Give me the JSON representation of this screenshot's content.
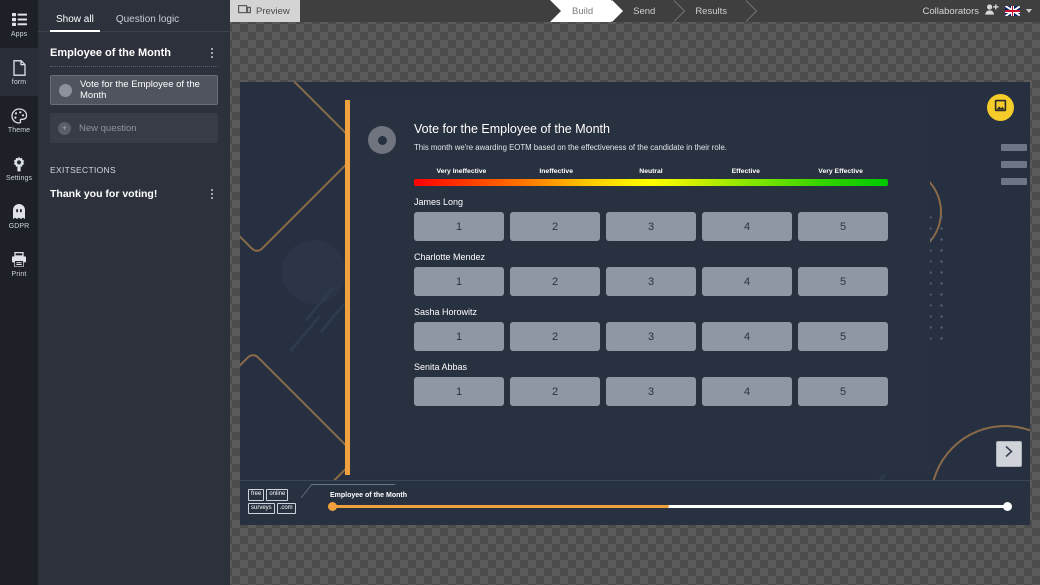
{
  "rail": {
    "items": [
      {
        "label": "Apps",
        "icon": "apps-list-icon",
        "active": false
      },
      {
        "label": "form",
        "icon": "document-icon",
        "active": true
      },
      {
        "label": "Theme",
        "icon": "palette-icon",
        "active": false
      },
      {
        "label": "Settings",
        "icon": "gear-icon",
        "active": false
      },
      {
        "label": "GDPR",
        "icon": "ghost-icon",
        "active": false
      },
      {
        "label": "Print",
        "icon": "printer-icon",
        "active": false
      }
    ]
  },
  "panel": {
    "tabs": [
      {
        "label": "Show all",
        "active": true
      },
      {
        "label": "Question logic",
        "active": false
      }
    ],
    "section_title": "Employee of the Month",
    "questions": [
      {
        "label": "Vote for the Employee of the Month",
        "state": "selected"
      },
      {
        "label": "New question",
        "state": "ghost"
      }
    ],
    "exit_label": "EXITSECTIONS",
    "exit_title": "Thank you for voting!"
  },
  "topbar": {
    "preview_label": "Preview",
    "steps": [
      {
        "label": "Build",
        "active": true
      },
      {
        "label": "Send",
        "active": false
      },
      {
        "label": "Results",
        "active": false
      }
    ],
    "collaborators_label": "Collaborators",
    "language_flag": "uk-flag-icon"
  },
  "survey": {
    "title": "Vote for the Employee of the Month",
    "subtitle": "This month we're awarding EOTM based on the effectiveness of the candidate in their role.",
    "scale_labels": [
      "Very Ineffective",
      "Ineffective",
      "Neutral",
      "Effective",
      "Very Effective"
    ],
    "options": [
      "1",
      "2",
      "3",
      "4",
      "5"
    ],
    "raters": [
      {
        "name": "James Long"
      },
      {
        "name": "Charlotte Mendez"
      },
      {
        "name": "Sasha Horowitz"
      },
      {
        "name": "Senita Abbas"
      }
    ],
    "save_icon": "save-image-icon",
    "next_icon": "chevron-right-icon"
  },
  "footer": {
    "brand": {
      "line1": [
        "free",
        "online"
      ],
      "line2": [
        "surveys",
        ".com"
      ]
    },
    "progress_label": "Employee of the Month",
    "progress_percent": 50
  },
  "colors": {
    "accent_orange": "#f0a03c",
    "card_bg": "#28313f",
    "canvas_bg": "#263040",
    "panel_bg": "#2d313c",
    "rail_bg": "#1d2027",
    "option_bg": "#8f96a4",
    "fab_yellow": "#f5cc29"
  }
}
